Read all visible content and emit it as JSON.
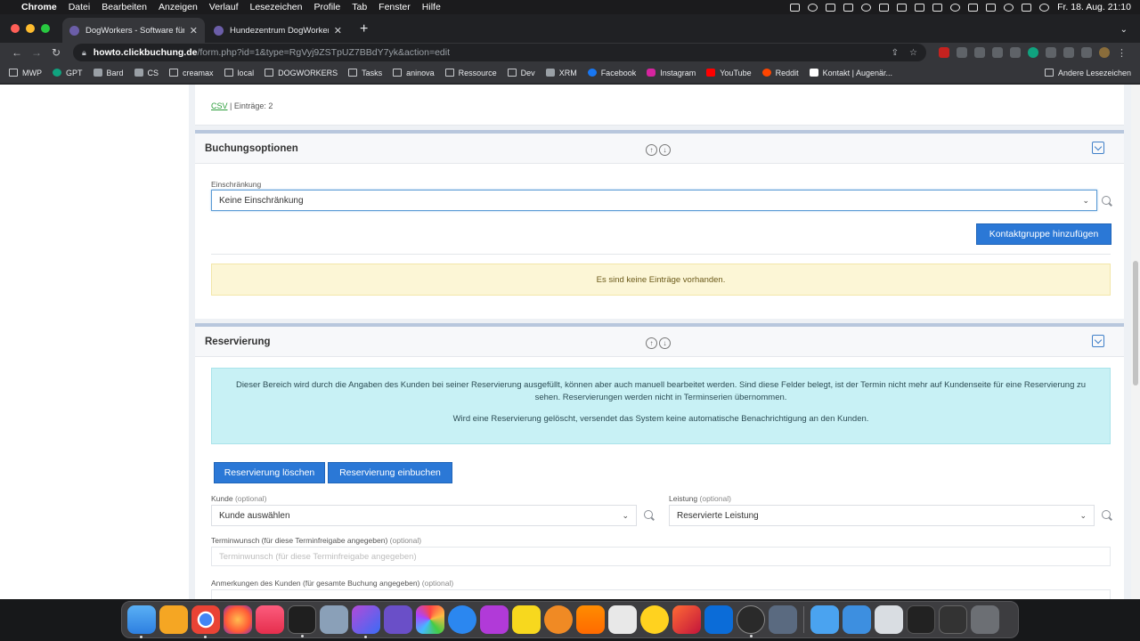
{
  "menubar": {
    "app": "Chrome",
    "items": [
      "Datei",
      "Bearbeiten",
      "Anzeigen",
      "Verlauf",
      "Lesezeichen",
      "Profile",
      "Tab",
      "Fenster",
      "Hilfe"
    ],
    "datetime": "Fr. 18. Aug. 21:10"
  },
  "tabs": [
    {
      "title": "DogWorkers - Software für die",
      "active": true
    },
    {
      "title": "Hundezentrum DogWorkers | E",
      "active": false
    }
  ],
  "toolbar": {
    "url_host": "howto.clickbuchung.de",
    "url_path": "/form.php?id=1&type=RgVyj9ZSTpUZ7BBdY7yk&action=edit"
  },
  "bookmarks": {
    "items": [
      {
        "label": "MWP",
        "icon": "folder"
      },
      {
        "label": "GPT",
        "icon": "gpt"
      },
      {
        "label": "Bard",
        "icon": "generic"
      },
      {
        "label": "CS",
        "icon": "generic"
      },
      {
        "label": "creamax",
        "icon": "folder"
      },
      {
        "label": "local",
        "icon": "folder"
      },
      {
        "label": "DOGWORKERS",
        "icon": "folder"
      },
      {
        "label": "Tasks",
        "icon": "folder"
      },
      {
        "label": "aninova",
        "icon": "folder"
      },
      {
        "label": "Ressource",
        "icon": "folder"
      },
      {
        "label": "Dev",
        "icon": "folder"
      },
      {
        "label": "XRM",
        "icon": "generic"
      },
      {
        "label": "Facebook",
        "icon": "fb"
      },
      {
        "label": "Instagram",
        "icon": "ig"
      },
      {
        "label": "YouTube",
        "icon": "yt"
      },
      {
        "label": "Reddit",
        "icon": "rd"
      },
      {
        "label": "Kontakt | Augenär...",
        "icon": "kt"
      }
    ],
    "other": "Andere Lesezeichen"
  },
  "page": {
    "csv_link": "CSV",
    "entries_count": "| Einträge: 2",
    "buchung": {
      "title": "Buchungsoptionen",
      "restriction_label": "Einschränkung",
      "restriction_value": "Keine Einschränkung",
      "add_contact_group_btn": "Kontaktgruppe hinzufügen",
      "empty_notice": "Es sind keine Einträge vorhanden."
    },
    "reservierung": {
      "title": "Reservierung",
      "info_p1": "Dieser Bereich wird durch die Angaben des Kunden bei seiner Reservierung ausgefüllt, können aber auch manuell bearbeitet werden. Sind diese Felder belegt, ist der Termin nicht mehr auf Kundenseite für eine Reservierung zu sehen. Reservierungen werden nicht in Terminserien übernommen.",
      "info_p2": "Wird eine Reservierung gelöscht, versendet das System keine automatische Benachrichtigung an den Kunden.",
      "delete_btn": "Reservierung löschen",
      "book_btn": "Reservierung einbuchen",
      "customer_label": "Kunde",
      "customer_value": "Kunde auswählen",
      "service_label": "Leistung",
      "service_value": "Reservierte Leistung",
      "optional": "(optional)",
      "wish_label": "Terminwunsch (für diese Terminfreigabe angegeben)",
      "wish_placeholder": "Terminwunsch (für diese Terminfreigabe angegeben)",
      "notes_label": "Anmerkungen des Kunden (für gesamte Buchung angegeben)"
    }
  },
  "colors": {
    "primary_button": "#2b78d6",
    "info_box": "#c8f1f5",
    "warning_box": "#fcf6d6",
    "csv_link": "#2a9d3a"
  }
}
